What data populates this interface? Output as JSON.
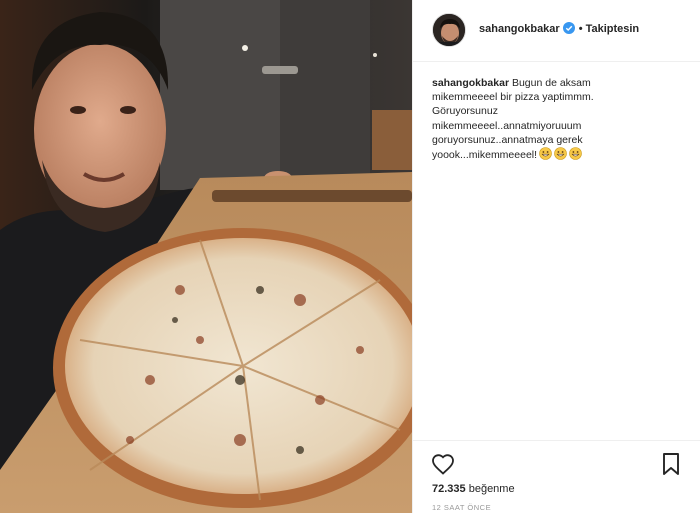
{
  "post": {
    "username": "sahangokbakar",
    "separator": "•",
    "follow_status": "Takiptesin",
    "caption_username": "sahangokbakar",
    "caption_text": " Bugun de aksam\nmikemmeeeel bir pizza yaptimmm.\nGöruyorsunuz\nmikemmeeeel..annatmiyoruuum\ngoruyorsunuz..annatmaya gerek\nyoook...mikemmeeeel!",
    "emojis": [
      "grinning-face-emoji",
      "grinning-face-emoji",
      "grinning-face-emoji"
    ],
    "likes_count": "72.335",
    "likes_label": " beğenme",
    "timestamp": "12 SAAT ÖNCE"
  },
  "icons": {
    "verified": "verified-badge-icon",
    "like": "heart-icon",
    "save": "bookmark-icon"
  },
  "colors": {
    "verified_blue": "#3897f0",
    "text": "#262626",
    "muted": "#999999",
    "border": "#efefef"
  }
}
